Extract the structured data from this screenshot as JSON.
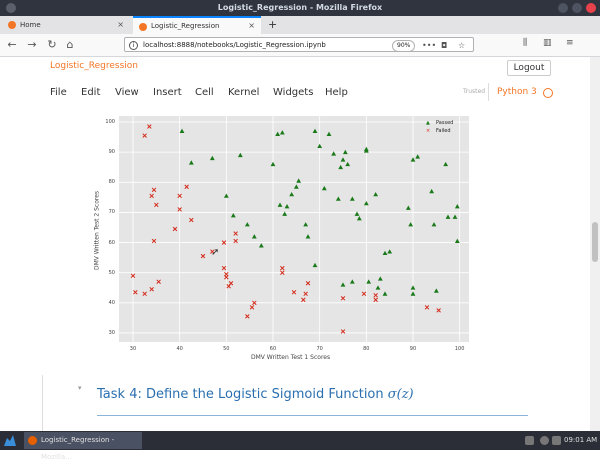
{
  "window": {
    "title": "Logistic_Regression - Mozilla Firefox"
  },
  "tabs": [
    {
      "label": "Home"
    },
    {
      "label": "Logistic_Regression"
    }
  ],
  "new_tab_symbol": "+",
  "close_symbol": "×",
  "url": "localhost:8888/notebooks/Logistic_Regression.ipynb",
  "zoom": "90%",
  "notebook": {
    "name": "Logistic_Regression",
    "logout": "Logout",
    "menu": [
      "File",
      "Edit",
      "View",
      "Insert",
      "Cell",
      "Kernel",
      "Widgets",
      "Help"
    ],
    "trusted": "Trusted",
    "kernel": "Python 3"
  },
  "chart_data": {
    "type": "scatter",
    "xlabel": "DMV Written Test 1 Scores",
    "ylabel": "DMV Written Test 2 Scores",
    "xlim": [
      27,
      102
    ],
    "ylim": [
      27,
      102
    ],
    "xticks": [
      "30",
      "40",
      "50",
      "60",
      "70",
      "80",
      "90",
      "100"
    ],
    "yticks": [
      "30",
      "40",
      "50",
      "60",
      "70",
      "80",
      "90",
      "100"
    ],
    "grid": true,
    "legend_position": "top-right",
    "series": [
      {
        "name": "Passed",
        "marker": "triangle",
        "color": "#1a7a1a",
        "points": [
          [
            40.5,
            97
          ],
          [
            42.5,
            86.5
          ],
          [
            47,
            88
          ],
          [
            50,
            75.5
          ],
          [
            51.5,
            69
          ],
          [
            53,
            89
          ],
          [
            54.5,
            66
          ],
          [
            56,
            62
          ],
          [
            57.5,
            59
          ],
          [
            60,
            86
          ],
          [
            61,
            96
          ],
          [
            61.5,
            72.5
          ],
          [
            62,
            96.5
          ],
          [
            62.5,
            69.5
          ],
          [
            63,
            72
          ],
          [
            64,
            76
          ],
          [
            65,
            78.5
          ],
          [
            65.5,
            80.5
          ],
          [
            67,
            66
          ],
          [
            67.5,
            62
          ],
          [
            69,
            52.5
          ],
          [
            69,
            97
          ],
          [
            70,
            92
          ],
          [
            71,
            78
          ],
          [
            72,
            96
          ],
          [
            73,
            89.5
          ],
          [
            74,
            74.5
          ],
          [
            74.5,
            85
          ],
          [
            75,
            87.5
          ],
          [
            75,
            46
          ],
          [
            75.5,
            90
          ],
          [
            76,
            86
          ],
          [
            77,
            47
          ],
          [
            77,
            74.5
          ],
          [
            78,
            69.5
          ],
          [
            78.5,
            68
          ],
          [
            80,
            91
          ],
          [
            80,
            90.5
          ],
          [
            80,
            73
          ],
          [
            80.5,
            47
          ],
          [
            82,
            76
          ],
          [
            82.5,
            45
          ],
          [
            83,
            48
          ],
          [
            84,
            56.5
          ],
          [
            84,
            43
          ],
          [
            85,
            57
          ],
          [
            89,
            71.5
          ],
          [
            89.5,
            66
          ],
          [
            90,
            45
          ],
          [
            90,
            43
          ],
          [
            90,
            87.5
          ],
          [
            91,
            88.5
          ],
          [
            94,
            77
          ],
          [
            94.5,
            66
          ],
          [
            95,
            44
          ],
          [
            97,
            86
          ],
          [
            97.5,
            68.5
          ],
          [
            99,
            68.5
          ],
          [
            99.5,
            72
          ],
          [
            99.5,
            60.5
          ]
        ]
      },
      {
        "name": "Failed",
        "marker": "x",
        "color": "#d42a1a",
        "points": [
          [
            30,
            49
          ],
          [
            30.5,
            43.5
          ],
          [
            32.5,
            95.5
          ],
          [
            32.5,
            43
          ],
          [
            33.5,
            98.5
          ],
          [
            34,
            75.5
          ],
          [
            34,
            44.5
          ],
          [
            34.5,
            77.5
          ],
          [
            34.5,
            60.5
          ],
          [
            35,
            72.5
          ],
          [
            35.5,
            47
          ],
          [
            39,
            64.5
          ],
          [
            40,
            75.5
          ],
          [
            40,
            71
          ],
          [
            41.5,
            78.5
          ],
          [
            42.5,
            67.5
          ],
          [
            45,
            55.5
          ],
          [
            47,
            57
          ],
          [
            49.5,
            60
          ],
          [
            49.5,
            51.5
          ],
          [
            50,
            49.5
          ],
          [
            50,
            48.5
          ],
          [
            50.5,
            45.5
          ],
          [
            51,
            46.5
          ],
          [
            52,
            63
          ],
          [
            52,
            60.5
          ],
          [
            54.5,
            35.5
          ],
          [
            55.5,
            38.5
          ],
          [
            56,
            40
          ],
          [
            62,
            50
          ],
          [
            62,
            51.5
          ],
          [
            64.5,
            43.5
          ],
          [
            66.5,
            41
          ],
          [
            67,
            43
          ],
          [
            67.5,
            46.5
          ],
          [
            75,
            41.5
          ],
          [
            75,
            30.5
          ],
          [
            79.5,
            43
          ],
          [
            82,
            42.5
          ],
          [
            82,
            41
          ],
          [
            93,
            38.5
          ],
          [
            95.5,
            37.5
          ]
        ]
      }
    ]
  },
  "markdown": {
    "heading_text": "Task 4: Define the Logistic Sigmoid Function",
    "heading_math": "σ(z)"
  },
  "taskbar": {
    "window_button": "Logistic_Regression - Mozilla...",
    "clock": "09:01 AM"
  }
}
